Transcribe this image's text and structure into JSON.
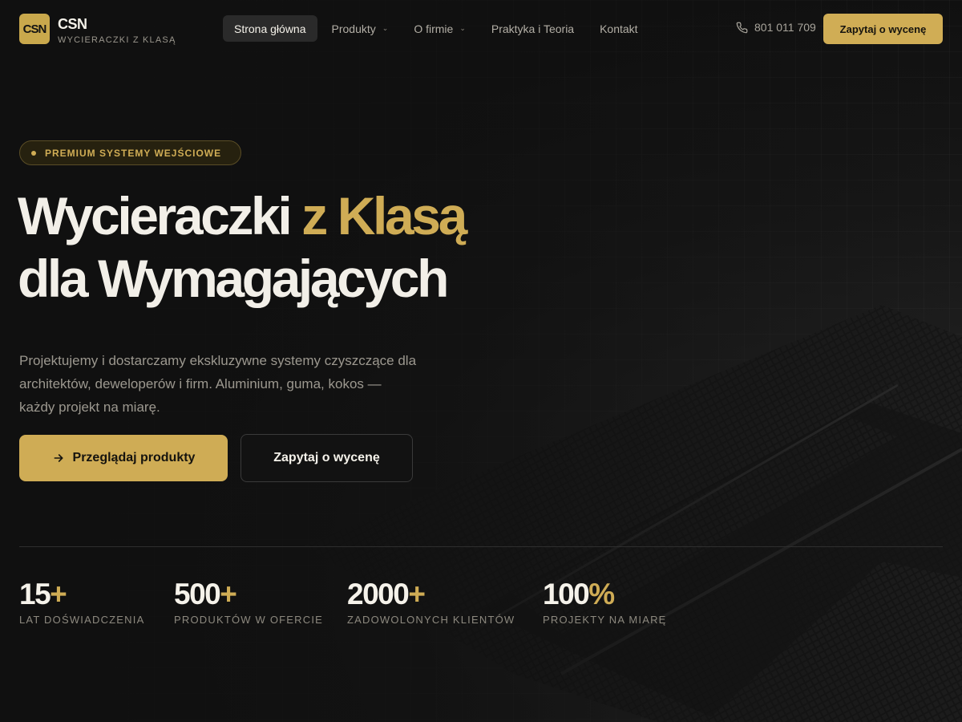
{
  "brand": {
    "logo_text": "CSN",
    "name": "CSN",
    "tagline": "WYCIERACZKI Z KLASĄ",
    "accent": "#cfac55"
  },
  "nav": {
    "items": [
      {
        "label": "Strona główna",
        "active": true,
        "dropdown": false
      },
      {
        "label": "Produkty",
        "active": false,
        "dropdown": true
      },
      {
        "label": "O firmie",
        "active": false,
        "dropdown": true
      },
      {
        "label": "Praktyka i Teoria",
        "active": false,
        "dropdown": false
      },
      {
        "label": "Kontakt",
        "active": false,
        "dropdown": false
      }
    ],
    "phone": "801 011 709",
    "cta_label": "Zapytaj o wycenę"
  },
  "hero": {
    "badge": "PREMIUM SYSTEMY WEJŚCIOWE",
    "headline_line1_main": "Wycieraczki",
    "headline_line1_accent": "z Klasą",
    "headline_line2": "dla Wymagających",
    "lead": "Projektujemy i dostarczamy ekskluzywne systemy czyszczące dla architektów, deweloperów i firm. Aluminium, guma, kokos — każdy projekt na miarę.",
    "primary_button": "Przeglądaj produkty",
    "secondary_button": "Zapytaj o wycenę"
  },
  "stats": [
    {
      "value": "15",
      "suffix": "+",
      "label": "LAT DOŚWIADCZENIA"
    },
    {
      "value": "500",
      "suffix": "+",
      "label": "PRODUKTÓW W OFERCIE"
    },
    {
      "value": "2000",
      "suffix": "+",
      "label": "ZADOWOLONYCH KLIENTÓW"
    },
    {
      "value": "100",
      "suffix": "%",
      "label": "PROJEKTY NA MIARĘ"
    }
  ],
  "icons": {
    "phone": "phone-icon",
    "arrow": "arrow-right-icon",
    "chevron": "chevron-down-icon"
  }
}
